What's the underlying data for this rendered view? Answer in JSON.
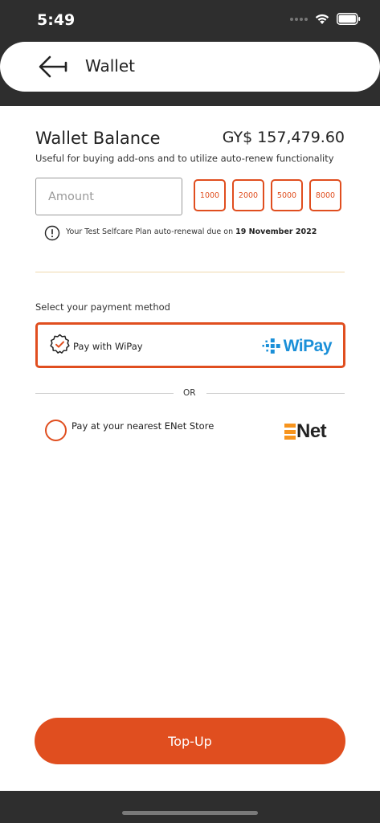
{
  "status_bar": {
    "time": "5:49"
  },
  "header": {
    "title": "Wallet"
  },
  "balance": {
    "label": "Wallet Balance",
    "amount": "GY$ 157,479.60",
    "description": "Useful for buying add-ons and to utilize auto-renew functionality"
  },
  "amount_input": {
    "placeholder": "Amount",
    "value": ""
  },
  "presets": [
    "1000",
    "2000",
    "5000",
    "8000"
  ],
  "notice": {
    "text": "Your Test Selfcare Plan auto-renewal due on ",
    "date": "19 November 2022"
  },
  "payment": {
    "label": "Select your payment method",
    "wipay_label": "Pay with WiPay",
    "wipay_logo_text": "WiPay",
    "or_text": "OR",
    "store_label": "Pay at your nearest ENet Store",
    "enet_logo_text": "Net"
  },
  "topup": {
    "label": "Top-Up"
  },
  "colors": {
    "accent": "#e04e1f",
    "dark": "#2e2e2e",
    "wipay_blue": "#1a8fd8",
    "enet_orange": "#f7941d"
  },
  "icons": {
    "back": "arrow-left-icon",
    "notice": "exclamation-circle-icon",
    "selected_method": "check-badge-icon",
    "wifi": "wifi-icon",
    "battery": "battery-icon"
  }
}
